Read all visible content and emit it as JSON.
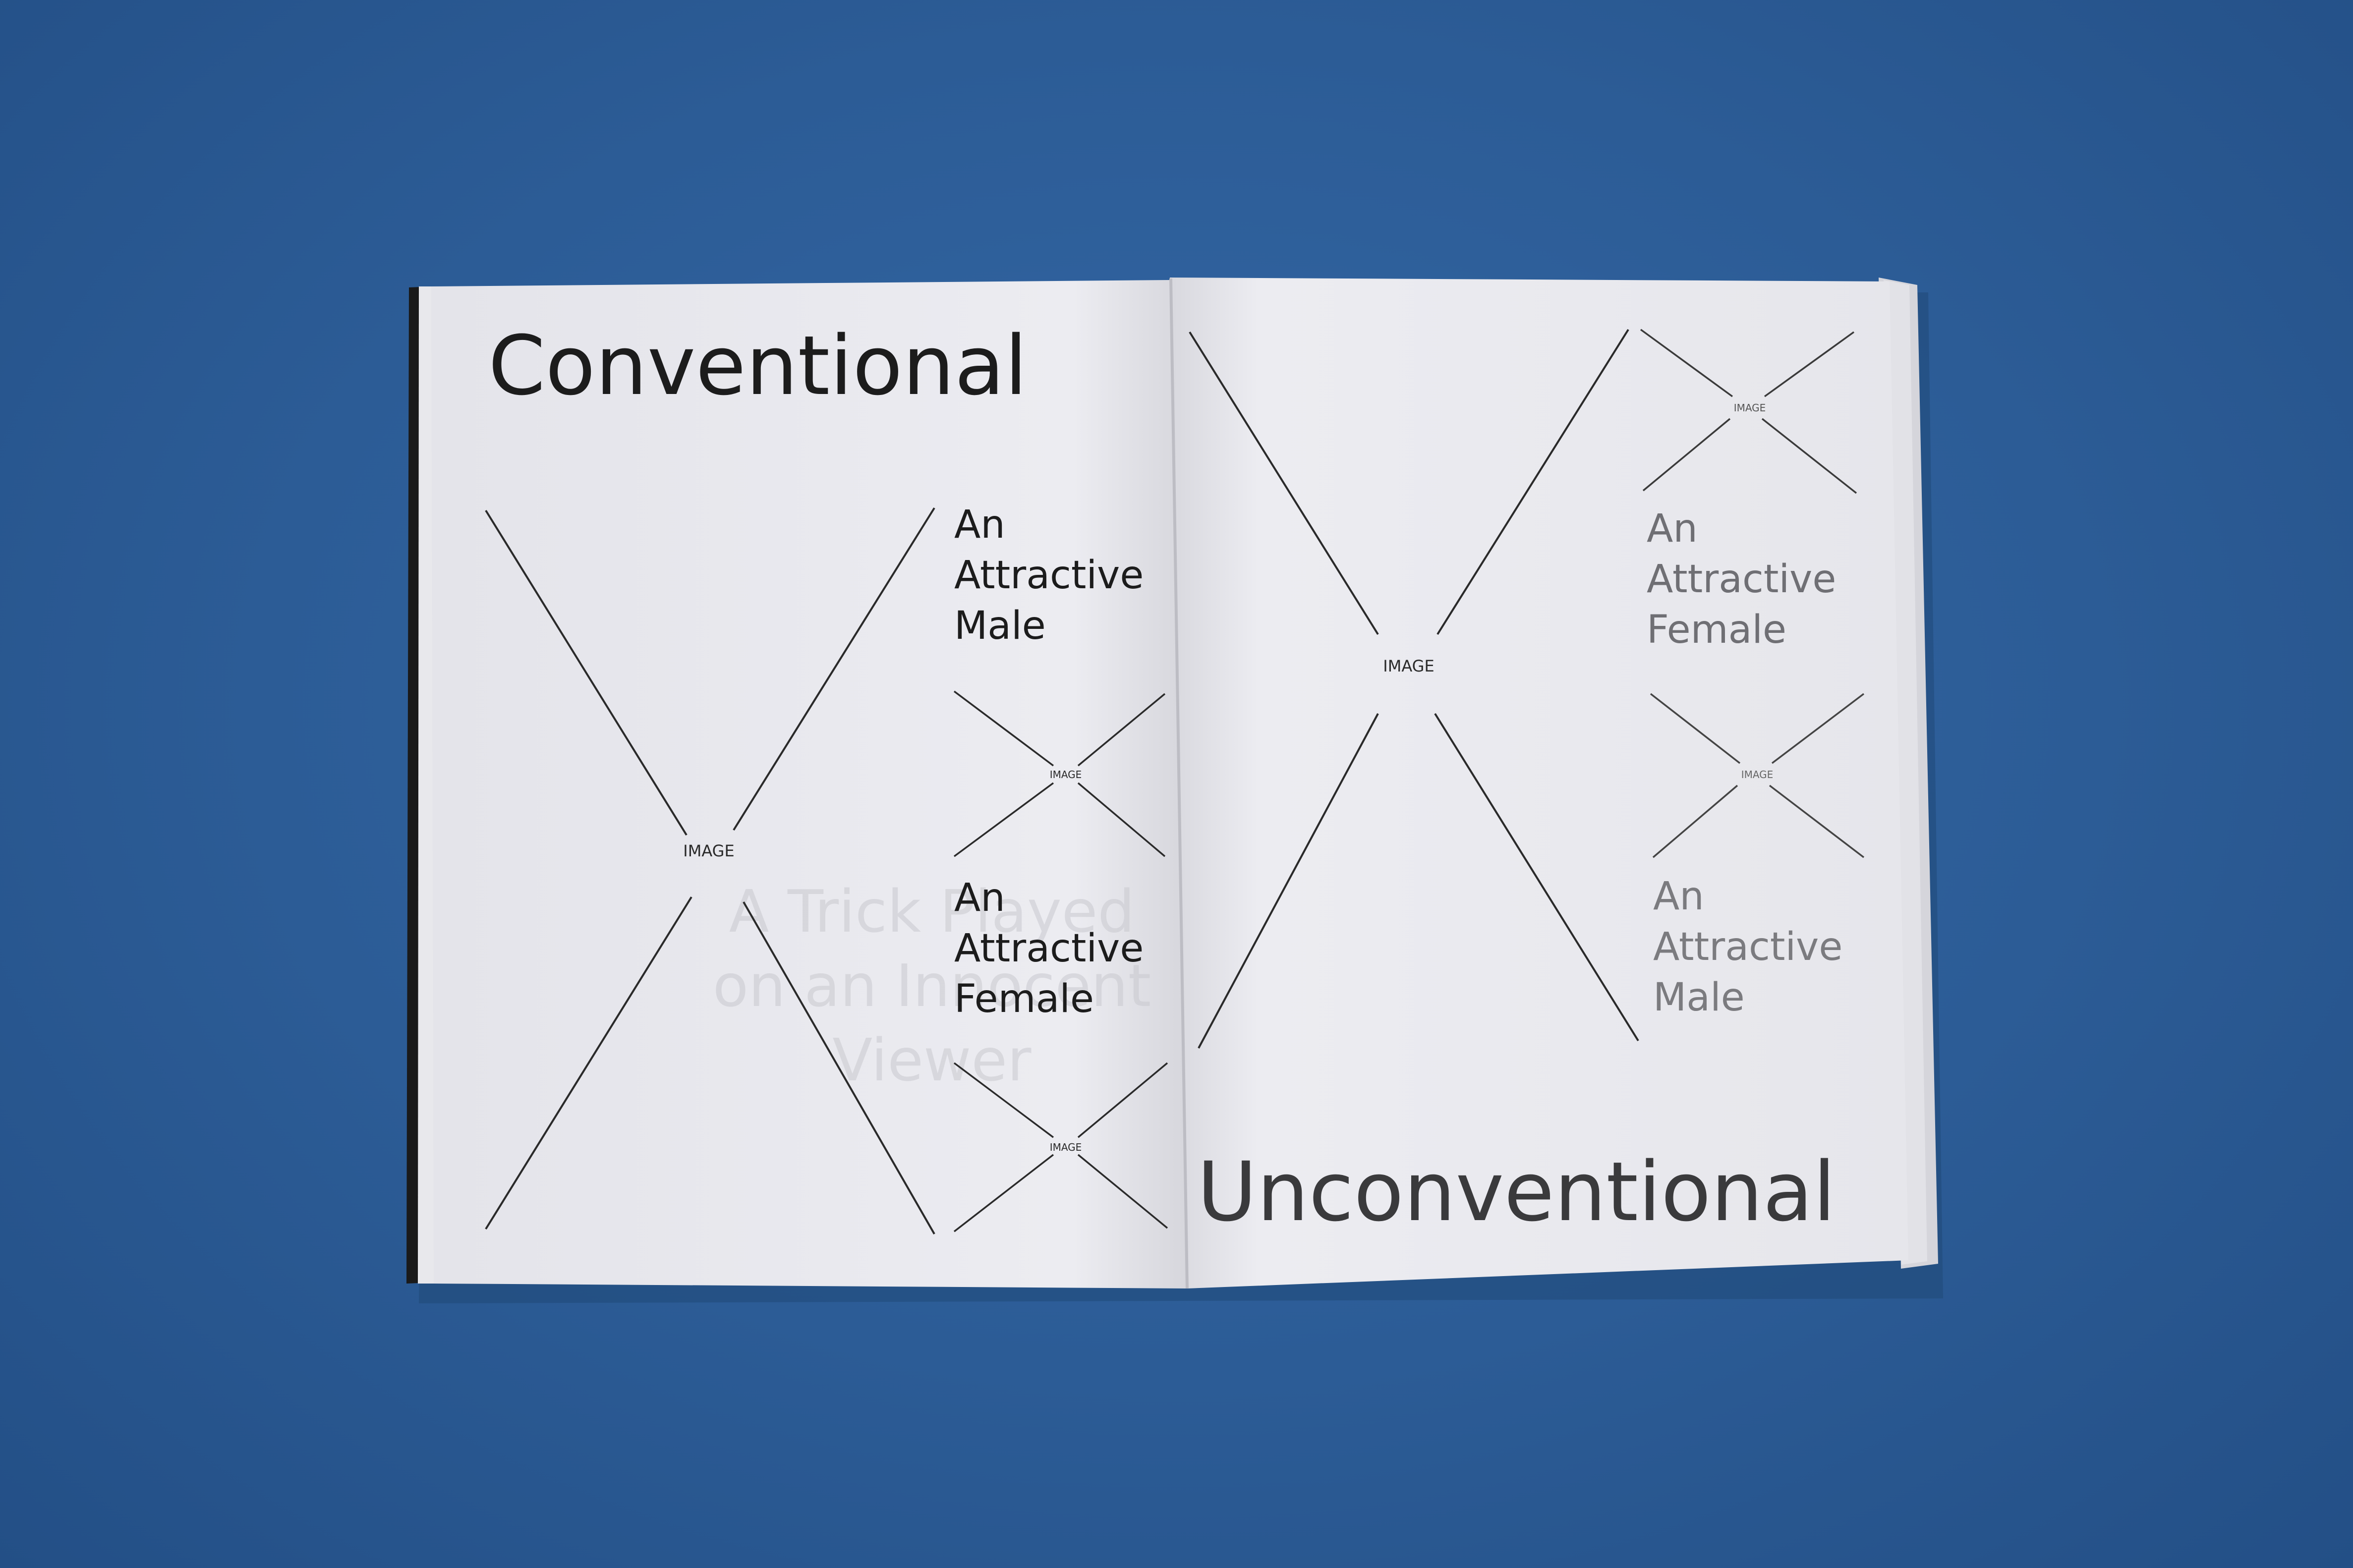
{
  "left_page": {
    "heading": "Conventional",
    "big_placeholder_label": "IMAGE",
    "caption_1": [
      "An",
      "Attractive",
      "Male"
    ],
    "small_placeholder_1_label": "IMAGE",
    "caption_2": [
      "An",
      "Attractive",
      "Female"
    ],
    "small_placeholder_2_label": "IMAGE"
  },
  "right_page": {
    "big_placeholder_label": "IMAGE",
    "small_placeholder_1_label": "IMAGE",
    "caption_1": [
      "An",
      "Attractive",
      "Female"
    ],
    "small_placeholder_2_label": "IMAGE",
    "caption_2": [
      "An",
      "Attractive",
      "Male"
    ],
    "heading": "Unconventional"
  },
  "show_through": {
    "lines": [
      "A Trick Played",
      "on an Innocent",
      "Viewer"
    ]
  },
  "colors": {
    "backdrop": "#2d5e98",
    "paper": "#ececf1",
    "ink": "#1c1c1c",
    "gray_ink": "#7b7b7f"
  }
}
